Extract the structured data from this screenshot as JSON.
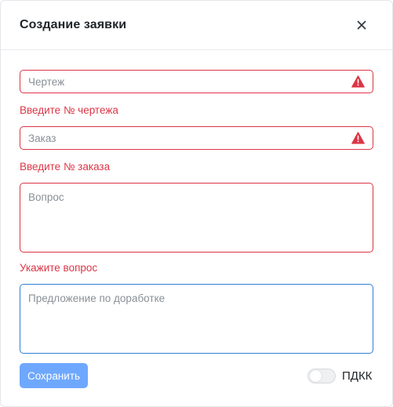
{
  "modal": {
    "title": "Создание заявки",
    "close_icon": "close-icon"
  },
  "form": {
    "drawing": {
      "placeholder": "Чертеж",
      "value": "",
      "error": "Введите № чертежа",
      "status_icon": "warning-icon"
    },
    "order": {
      "placeholder": "Заказ",
      "value": "",
      "error": "Введите № заказа",
      "status_icon": "warning-icon"
    },
    "question": {
      "placeholder": "Вопрос",
      "value": "",
      "error": "Укажите вопрос"
    },
    "improvement": {
      "placeholder": "Предложение по доработке",
      "value": ""
    }
  },
  "footer": {
    "save_label": "Сохранить",
    "toggle_label": "ПДКК",
    "toggle_on": false
  },
  "colors": {
    "error": "#dc3545",
    "primary": "#6ea8fe",
    "focus_border": "#2f7fd7"
  }
}
